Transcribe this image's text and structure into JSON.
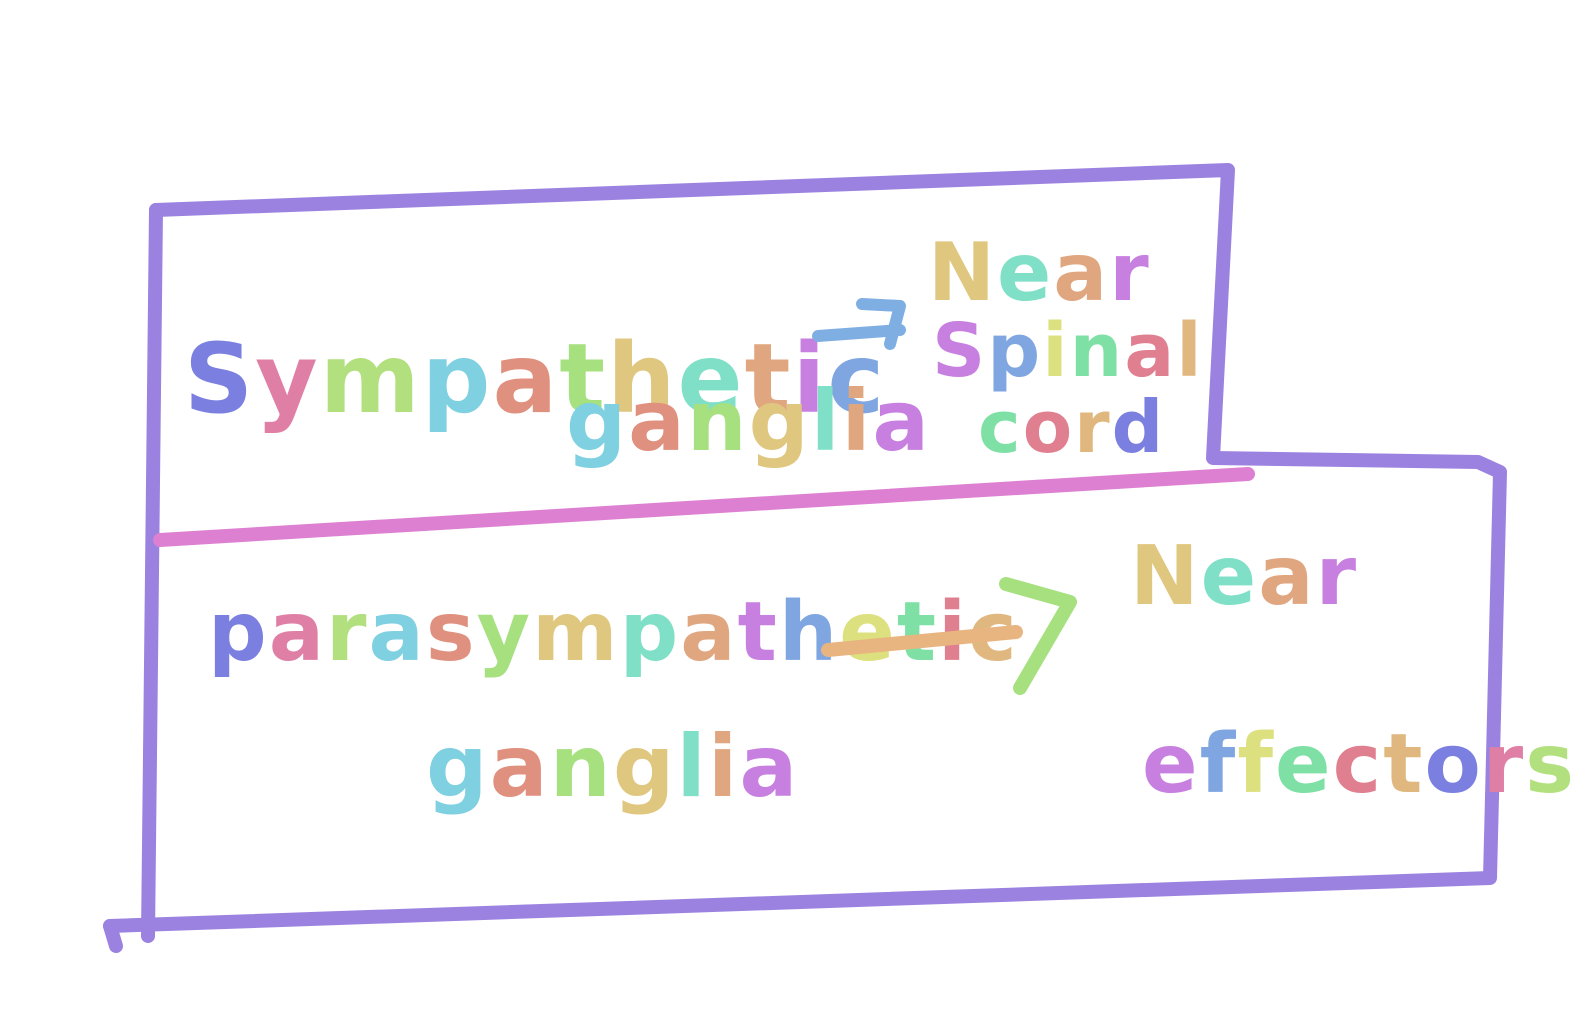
{
  "colors": {
    "background": "#ffffff",
    "frame": "#9b82e0",
    "divider": "#dd80d2",
    "arrow_top": "#7faee3",
    "arrow_bottom_shaft": "#e8b580",
    "arrow_bottom_head": "#a6e07f"
  },
  "letter_palette": [
    "#7b7fe0",
    "#e07fa6",
    "#b3e07f",
    "#7fd0e0",
    "#e0907f",
    "#a6e07f",
    "#e0c77f",
    "#7fe0c7",
    "#e0a67f",
    "#c77fe0",
    "#7fa6e0",
    "#dde07f",
    "#7fe0a6",
    "#e07f90",
    "#e0b87f"
  ],
  "sympathetic": {
    "ganglion_type": "Sympathetic",
    "ganglion_word": "ganglia",
    "arrow_icon": "arrow-right-icon",
    "location_line1": "Near",
    "location_line2": "Spinal",
    "location_line3": "cord"
  },
  "parasympathetic": {
    "ganglion_type": "parasympathetic",
    "ganglion_word": "ganglia",
    "arrow_icon": "arrow-right-icon",
    "location_line1": "Near",
    "location_line2": "effectors"
  }
}
